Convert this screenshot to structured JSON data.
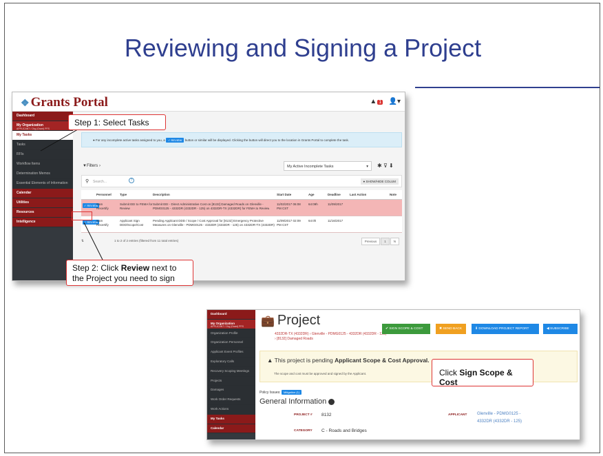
{
  "slide": {
    "title": "Reviewing and Signing a Project"
  },
  "portal": {
    "logo_text": "Grants Portal",
    "bell_count": "1",
    "sidebar": [
      {
        "label": "Dashboard",
        "style": "red"
      },
      {
        "label": "My Organization",
        "sub": "APPLICANT / Org (Grant) PFS",
        "style": "red2"
      },
      {
        "label": "My Tasks",
        "style": "white"
      },
      {
        "label": "Tasks",
        "style": "sub"
      },
      {
        "label": "RFIs",
        "style": "sub"
      },
      {
        "label": "Workflow Items",
        "style": "sub"
      },
      {
        "label": "Determination Memos",
        "style": "sub"
      },
      {
        "label": "Essential Elements of Information",
        "style": "sub"
      },
      {
        "label": "Calendar",
        "style": "red"
      },
      {
        "label": "Utilities",
        "style": "red"
      },
      {
        "label": "Resources",
        "style": "red"
      },
      {
        "label": "Intelligence",
        "style": "red"
      }
    ],
    "info_text_before": "For any incomplete active tasks assigned to you, a",
    "info_review_chip": "✓ REVIEW",
    "info_text_after": "button or similar will be displayed. Clicking the button will direct you to the location in Grants Portal to complete the task.",
    "filters_label": "▼Filters ›",
    "task_select": "My Active Incomplete Tasks",
    "search_placeholder": "Search...",
    "show_hide": "● SHOW/HIDE COLUM",
    "columns": [
      "Personnel",
      "Type",
      "Description",
      "Start Date",
      "Age",
      "Deadline",
      "Last Action",
      "Note"
    ],
    "rows": [
      {
        "button": "✓ REVIEW",
        "personnel": [
          "Sam",
          "Recertify"
        ],
        "type": [
          "Submit EEI to FEMA for",
          "Review"
        ],
        "description": [
          "Submit EEI - Direct Administrative Cost on [8132] Damaged Roads on Glenville -",
          "PDMG0125 - 4332DR (4332DR - 125) on 4332DR-TX (4332DR) for FEMA to Review"
        ],
        "start": [
          "11/02/2017 06:08",
          "PM CST"
        ],
        "age": "64:09h",
        "deadline": "11/09/2017"
      },
      {
        "button": "✓ REVIEW",
        "personnel": [
          "Sam",
          "Recertify"
        ],
        "type": [
          "Applicant Sign",
          "DDD/Scope/Cost"
        ],
        "description": [
          "Pending Applicant DDD / Scope / Cost Approval for [8132] Emergency Protective",
          "Measures on Glenville - PDMG0125 - 4332DR (4332DR - 125) on 4332DR-TX (4332DR)"
        ],
        "start": [
          "11/09/2017 02:09",
          "PM CST"
        ],
        "age": "64:0h",
        "deadline": "11/16/2017"
      }
    ],
    "entries_text": "1 to 2 of 2 entries (filtered from 11 total entries)",
    "pager_prev": "Previous",
    "pager_page": "1",
    "pager_next": "N"
  },
  "callouts": {
    "step1_prefix": "Step 1: Select ",
    "step1_bold": "Tasks",
    "step2_prefix": "Step 2: Click ",
    "step2_bold": "Review",
    "step2_suffix": " next to",
    "step2_line2": "the Project you need to sign",
    "step3_prefix": "Click ",
    "step3_bold": "Sign Scope & Cost"
  },
  "project": {
    "sidebar": [
      {
        "label": "Dashboard",
        "style": "red"
      },
      {
        "label": "My Organization",
        "sub": "APPLICANT / Org (Grant) PFS",
        "style": "red2"
      },
      {
        "label": "Organization Profile",
        "style": "sub"
      },
      {
        "label": "Organization Personnel",
        "style": "sub"
      },
      {
        "label": "Applicant Event Profiles",
        "style": "sub"
      },
      {
        "label": "Exploratory Calls",
        "style": "sub"
      },
      {
        "label": "Recovery Scoping Meetings",
        "style": "sub"
      },
      {
        "label": "Projects",
        "style": "sub"
      },
      {
        "label": "Damages",
        "style": "sub"
      },
      {
        "label": "Work Order Requests",
        "style": "sub"
      },
      {
        "label": "Work Actions",
        "style": "sub"
      },
      {
        "label": "My Tasks",
        "style": "red"
      },
      {
        "label": "Calendar",
        "style": "red"
      }
    ],
    "title": "Project",
    "subtitle_line1": "4332DR-TX (4332DR) › Glenville - PDMG0125 - 4332DR (4332DR - 125)",
    "subtitle_line2": "› [8132] Damaged Roads",
    "btn_sign": "✔ SIGN SCOPE & COST",
    "btn_send_back": "✖ SEND BACK",
    "btn_download": "⬇ DOWNLOAD PROJECT REPORT",
    "btn_subscribe": "◀ SUBSCRIBE",
    "banner_prefix": "This project is pending ",
    "banner_bold": "Applicant Scope & Cost Approval.",
    "banner_text": "The scope and cost must be approved and signed by the Applicant.",
    "policy_label": "Policy Issues:",
    "policy_tag": "Mitigation (1)",
    "gen_info": "General Information",
    "project_num_label": "PROJECT #",
    "project_num": "8132",
    "category_label": "CATEGORY",
    "category": "C - Roads and Bridges",
    "applicant_label": "APPLICANT",
    "applicant_line1": "Glenville - PDMG0125 -",
    "applicant_line2": "4332DR (4332DR - 125)",
    "colors": {
      "sign": "#3c9a3c",
      "send_back": "#f0a020",
      "download": "#1e88e5",
      "subscribe": "#1e88e5"
    }
  }
}
